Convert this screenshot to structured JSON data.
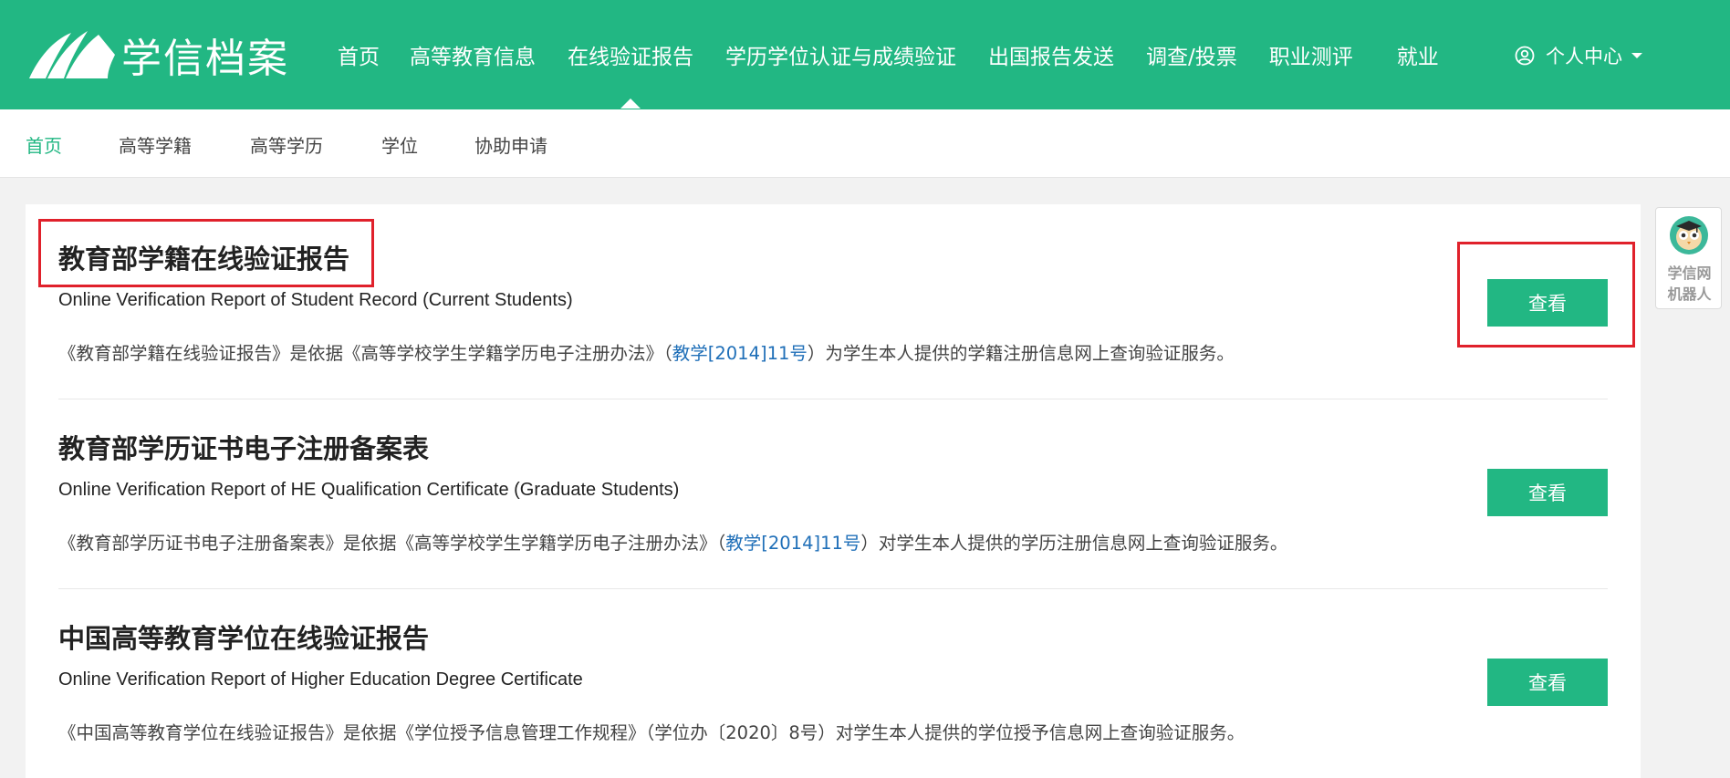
{
  "header": {
    "logo_text": "学信档案",
    "nav": [
      {
        "label": "首页"
      },
      {
        "label": "高等教育信息"
      },
      {
        "label": "在线验证报告"
      },
      {
        "label": "学历学位认证与成绩验证"
      },
      {
        "label": "出国报告发送"
      },
      {
        "label": "调查/投票"
      },
      {
        "label": "职业测评"
      },
      {
        "label": "就业"
      }
    ],
    "user_menu_label": "个人中心"
  },
  "subnav": {
    "items": [
      {
        "label": "首页"
      },
      {
        "label": "高等学籍"
      },
      {
        "label": "高等学历"
      },
      {
        "label": "学位"
      },
      {
        "label": "协助申请"
      }
    ]
  },
  "reports": [
    {
      "title": "教育部学籍在线验证报告",
      "subtitle": "Online Verification Report of Student Record (Current Students)",
      "desc_before": "《教育部学籍在线验证报告》是依据《高等学校学生学籍学历电子注册办法》（",
      "desc_link": "教学[2014]11号",
      "desc_after": "）为学生本人提供的学籍注册信息网上查询验证服务。",
      "button": "查看"
    },
    {
      "title": "教育部学历证书电子注册备案表",
      "subtitle": "Online Verification Report of HE Qualification Certificate (Graduate Students)",
      "desc_before": "《教育部学历证书电子注册备案表》是依据《高等学校学生学籍学历电子注册办法》（",
      "desc_link": "教学[2014]11号",
      "desc_after": "）对学生本人提供的学历注册信息网上查询验证服务。",
      "button": "查看"
    },
    {
      "title": "中国高等教育学位在线验证报告",
      "subtitle": "Online Verification Report of Higher Education Degree Certificate",
      "desc_before": "《中国高等教育学位在线验证报告》是依据《学位授予信息管理工作规程》（学位办〔2020〕8号）对学生本人提供的学位授予信息网上查询验证服务。",
      "desc_link": "",
      "desc_after": "",
      "button": "查看"
    }
  ],
  "robot": {
    "line1": "学信网",
    "line2": "机器人"
  },
  "colors": {
    "brand_green": "#22b783",
    "highlight_red": "#e0212b",
    "link_blue": "#1f6fb8"
  }
}
